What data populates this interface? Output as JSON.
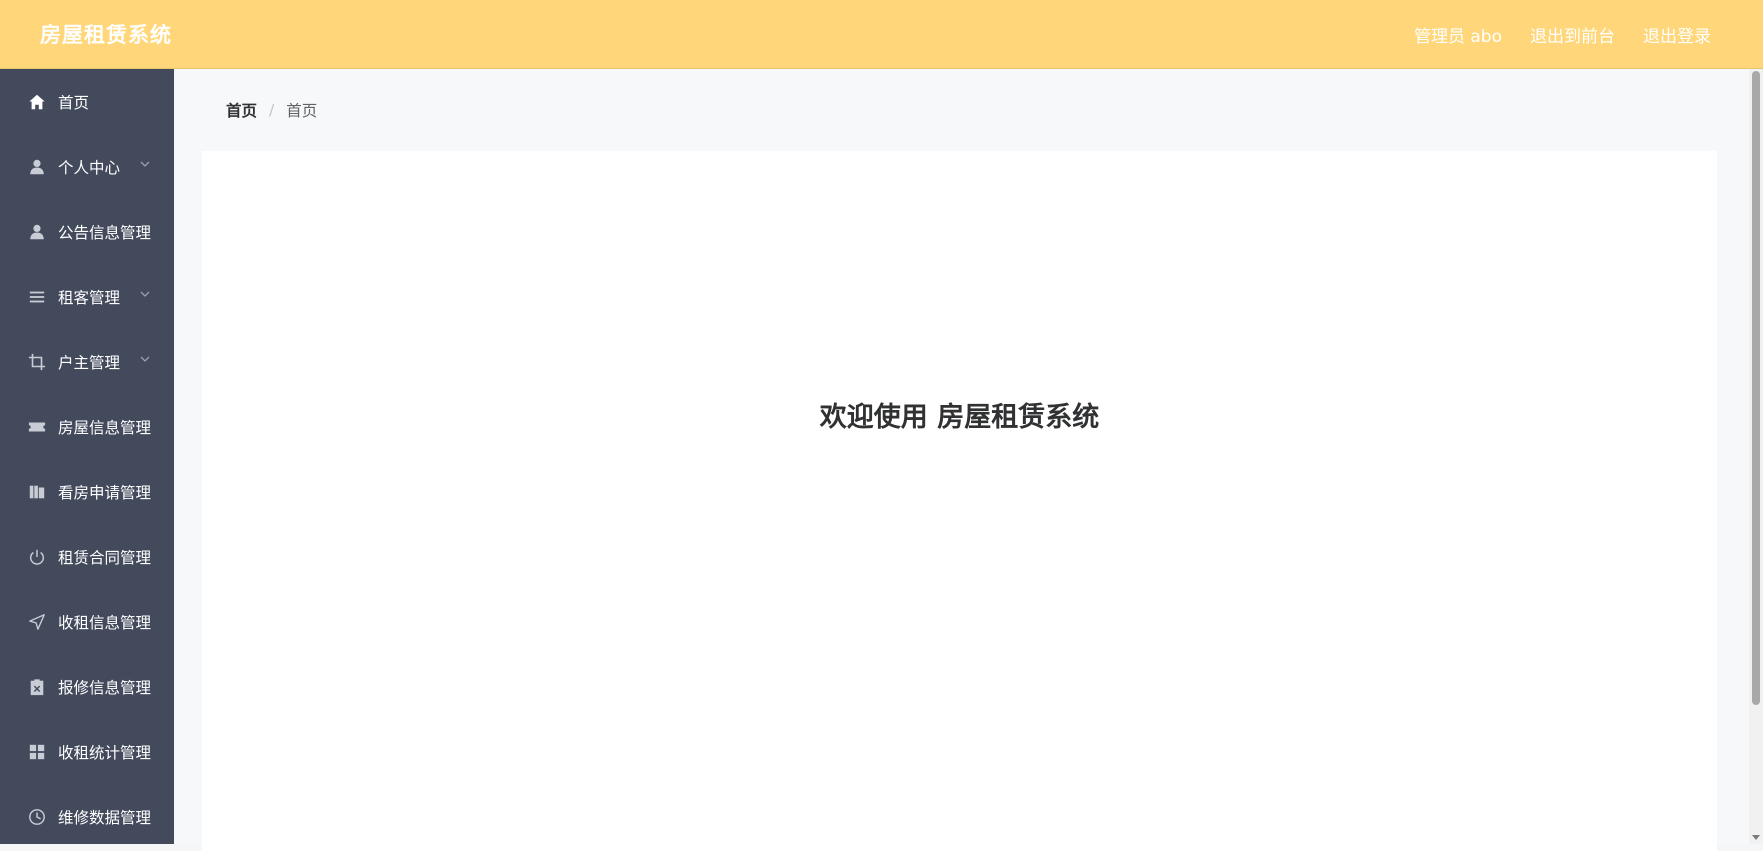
{
  "header": {
    "title": "房屋租赁系统",
    "admin_label": "管理员 abo",
    "to_front_label": "退出到前台",
    "logout_label": "退出登录",
    "bg_color": "#ffd77a"
  },
  "sidebar": {
    "bg_color": "#424a5c",
    "items": [
      {
        "label": "首页",
        "icon": "home-icon",
        "has_children": false
      },
      {
        "label": "个人中心",
        "icon": "user-icon",
        "has_children": true
      },
      {
        "label": "公告信息管理",
        "icon": "user-icon",
        "has_children": false
      },
      {
        "label": "租客管理",
        "icon": "list-icon",
        "has_children": true
      },
      {
        "label": "户主管理",
        "icon": "crop-icon",
        "has_children": true
      },
      {
        "label": "房屋信息管理",
        "icon": "ticket-icon",
        "has_children": false
      },
      {
        "label": "看房申请管理",
        "icon": "books-icon",
        "has_children": false
      },
      {
        "label": "租赁合同管理",
        "icon": "power-icon",
        "has_children": false
      },
      {
        "label": "收租信息管理",
        "icon": "send-icon",
        "has_children": false
      },
      {
        "label": "报修信息管理",
        "icon": "clipboard-x-icon",
        "has_children": false
      },
      {
        "label": "收租统计管理",
        "icon": "grid-icon",
        "has_children": false
      },
      {
        "label": "维修数据管理",
        "icon": "clock-icon",
        "has_children": false
      }
    ]
  },
  "breadcrumb": {
    "items": [
      "首页",
      "首页"
    ],
    "separator": "/"
  },
  "main": {
    "welcome_text": "欢迎使用 房屋租赁系统"
  }
}
